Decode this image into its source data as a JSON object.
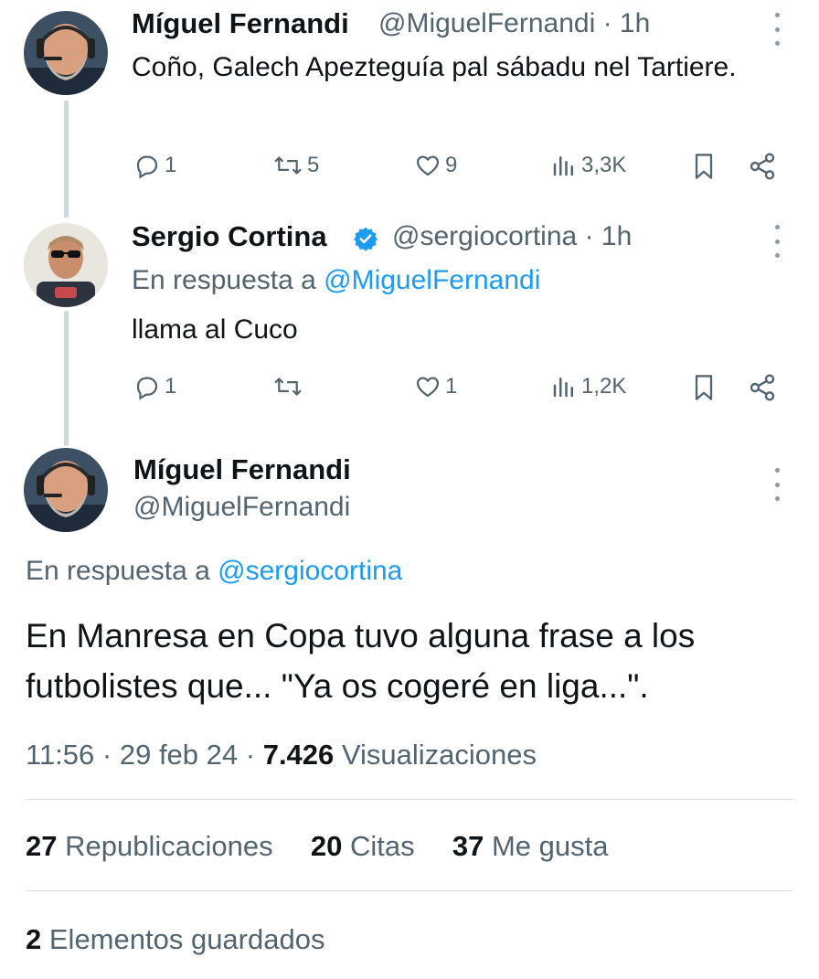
{
  "tweets": [
    {
      "name": "Míguel Fernandi",
      "handle": "@MiguelFernandi",
      "time": "· 1h",
      "text": "Coño, Galech Apezteguía pal sábadu nel Tartiere.",
      "replies": "1",
      "reposts": "5",
      "likes": "9",
      "views": "3,3K"
    },
    {
      "name": "Sergio Cortina",
      "handle": "@sergiocortina",
      "time": "· 1h",
      "reply_prefix": "En respuesta a",
      "reply_to": "@MiguelFernandi",
      "text": "llama al Cuco",
      "replies": "1",
      "reposts": "",
      "likes": "1",
      "views": "1,2K"
    }
  ],
  "main_tweet": {
    "name": "Míguel Fernandi",
    "handle": "@MiguelFernandi",
    "reply_prefix": "En respuesta a",
    "reply_to": "@sergiocortina",
    "text_line1": "En Manresa en Copa tuvo alguna frase a los",
    "text_line2": "futbolistes que... \"Ya os cogeré en liga...\".",
    "time": "11:56",
    "date": "29 feb 24",
    "views_count": "7.426",
    "views_label": "Visualizaciones",
    "reposts_count": "27",
    "reposts_label": "Republicaciones",
    "quotes_count": "20",
    "quotes_label": "Citas",
    "likes_count": "37",
    "likes_label": "Me gusta",
    "bookmarks_count": "2",
    "bookmarks_label": "Elementos guardados"
  },
  "colors": {
    "link": "#1d9bf0",
    "muted": "#536471",
    "verified": "#1d9bf0"
  },
  "icons": [
    "reply-icon",
    "repost-icon",
    "like-icon",
    "views-icon",
    "bookmark-icon",
    "share-icon",
    "more-icon",
    "verified-badge-icon"
  ]
}
